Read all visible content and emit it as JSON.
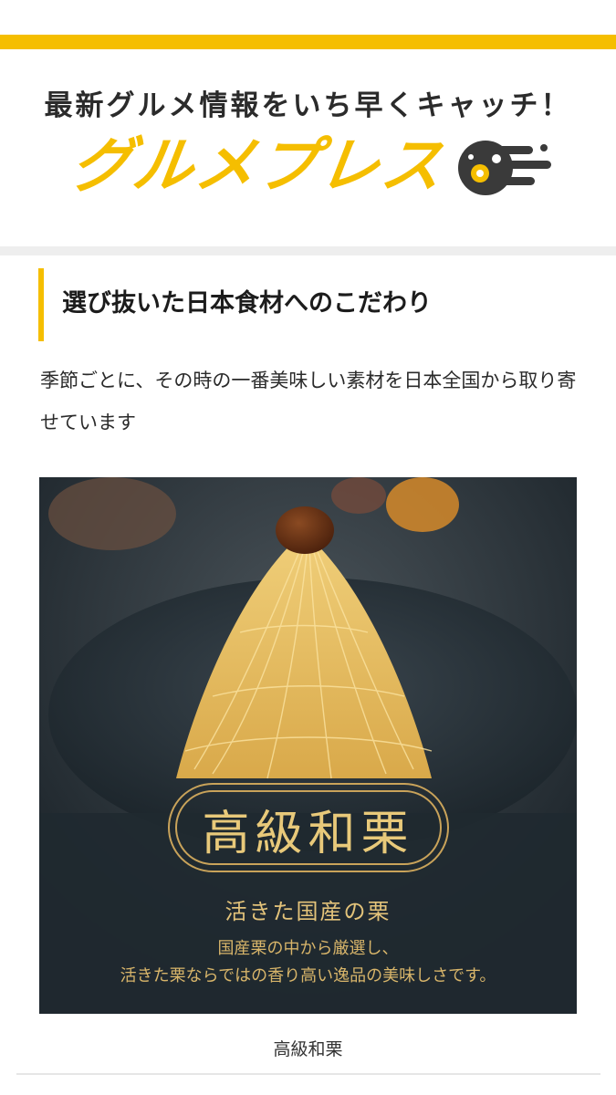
{
  "header": {
    "tagline": "最新グルメ情報をいち早くキャッチ！",
    "logo_text": "グルメプレス",
    "brand_color": "#f5be00"
  },
  "article": {
    "title": "選び抜いた日本食材へのこだわり",
    "description": "季節ごとに、その時の一番美味しい素材を日本全国から取り寄せています",
    "image": {
      "badge": "高級和栗",
      "subtitle": "活きた国産の栗",
      "line1": "国産栗の中から厳選し、",
      "line2": "活きた栗ならではの香り高い逸品の美味しさです。"
    },
    "caption": "高級和栗"
  }
}
